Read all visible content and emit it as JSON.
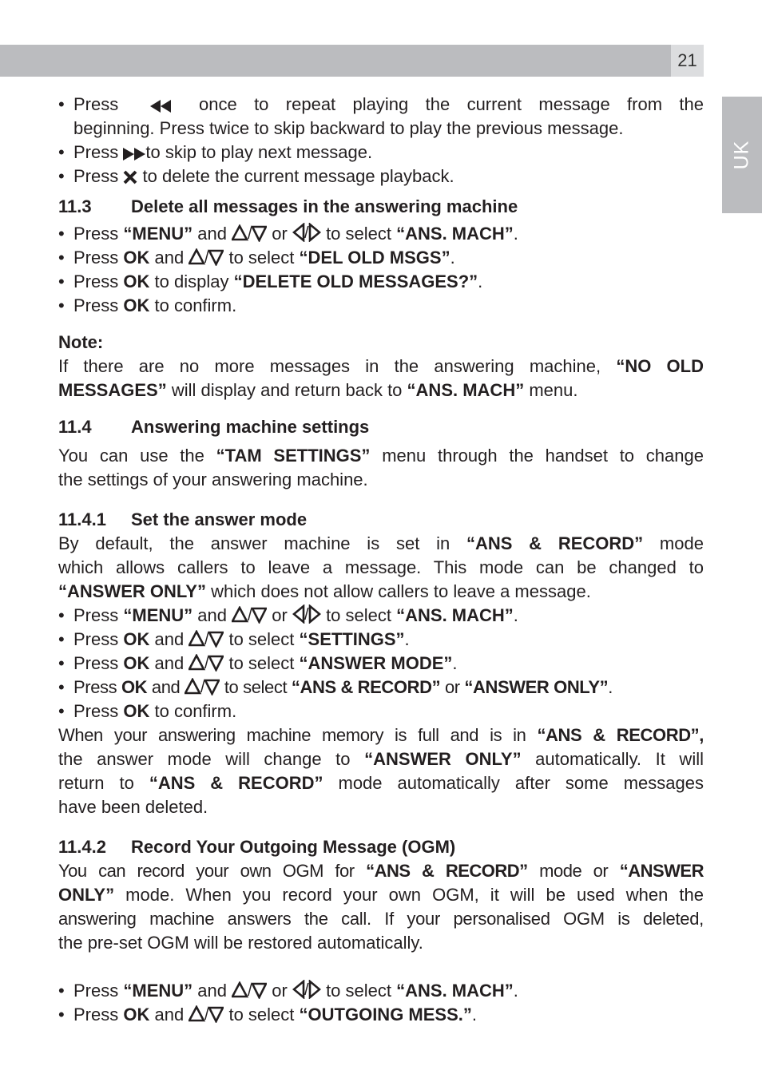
{
  "header": {
    "page_number": "21",
    "language_tab": "UK"
  },
  "intro_bullets": [
    {
      "pre": "Press",
      "icon": "rewind-icon",
      "post": "once to repeat playing the current message from the",
      "cont": "beginning. Press twice to skip backward to play the previous message."
    },
    {
      "pre": "Press",
      "icon": "fast-forward-icon",
      "post": "to skip to play next message."
    },
    {
      "pre": "Press",
      "icon": "delete-x-icon",
      "post": "to delete the current message playback."
    }
  ],
  "s113": {
    "num": "11.3",
    "title": "Delete all messages in the answering machine",
    "b1": {
      "press": "Press",
      "menu": "“MENU”",
      "and": "and",
      "or": "or",
      "to_select": "to select",
      "target": "“ANS. MACH”",
      "end": "."
    },
    "b2": {
      "press": "Press",
      "ok": "OK",
      "and": "and",
      "to_select": "to select",
      "target": "“DEL OLD MSGS”",
      "end": "."
    },
    "b3": {
      "press": "Press",
      "ok": "OK",
      "text": "to display",
      "target": "“DELETE OLD MESSAGES?”",
      "end": "."
    },
    "b4": {
      "press": "Press",
      "ok": "OK",
      "text": "to confirm."
    }
  },
  "note": {
    "label": "Note:",
    "l1_text": "If there are no more messages in the answering machine,",
    "l1_bold": "“NO OLD",
    "l2_bold": "MESSAGES”",
    "l2_text": "will display and return back to",
    "l2_bold2": "“ANS. MACH”",
    "l2_end": "menu."
  },
  "s114": {
    "num": "11.4",
    "title": "Answering machine settings",
    "p1_a": "You can use the",
    "p1_b": "“TAM SETTINGS”",
    "p1_c": "menu through the handset to change",
    "p2": "the settings of your answering machine."
  },
  "s1141": {
    "num": "11.4.1",
    "title": "Set the answer mode",
    "l1_a": "By default, the answer machine is set in",
    "l1_b": "“ANS & RECORD”",
    "l1_c": "mode",
    "l2": "which allows callers to leave a message. This mode can be changed to",
    "l3_b": "“ANSWER ONLY”",
    "l3_c": "which does not allow callers to leave a message.",
    "b1": {
      "press": "Press",
      "menu": "“MENU”",
      "and": "and",
      "or": "or",
      "to_select": "to select",
      "target": "“ANS. MACH”",
      "end": "."
    },
    "b2": {
      "press": "Press",
      "ok": "OK",
      "and": "and",
      "to_select": "to select",
      "target": "“SETTINGS”",
      "end": "."
    },
    "b3": {
      "press": "Press",
      "ok": "OK",
      "and": "and",
      "to_select": "to select",
      "target": "“ANSWER MODE”",
      "end": "."
    },
    "b4": {
      "press": "Press",
      "ok": "OK",
      "and": "and",
      "to_select": "to select",
      "target": "“ANS & RECORD”",
      "or": "or",
      "target2": "“ANSWER ONLY”",
      "end": "."
    },
    "b5": {
      "press": "Press",
      "ok": "OK",
      "text": "to confirm."
    },
    "p_l1_a": "When your answering machine memory is full and is in",
    "p_l1_b": "“ANS & RECORD”,",
    "p_l2_a": "the answer mode will change to",
    "p_l2_b": "“ANSWER ONLY”",
    "p_l2_c": "automatically. It will",
    "p_l3_a": "return to",
    "p_l3_b": "“ANS & RECORD”",
    "p_l3_c": "mode automatically after some messages",
    "p_l4": "have been deleted."
  },
  "s1142": {
    "num": "11.4.2",
    "title": "Record Your Outgoing Message (OGM)",
    "l1_a": "You can record your own OGM for",
    "l1_b": "“ANS & RECORD”",
    "l1_c": "mode or",
    "l1_d": "“ANSWER",
    "l2_b": "ONLY”",
    "l2_c": "mode. When you record your own OGM, it will be used when the",
    "l3": "answering machine answers the call. If your personalised OGM is deleted,",
    "l4": "the pre-set OGM will be restored automatically.",
    "b1": {
      "press": "Press",
      "menu": "“MENU”",
      "and": "and",
      "or": "or",
      "to_select": "to select",
      "target": "“ANS. MACH”",
      "end": "."
    },
    "b2": {
      "press": "Press",
      "ok": "OK",
      "and": "and",
      "to_select": "to select",
      "target": "“OUTGOING MESS.”",
      "end": "."
    }
  }
}
